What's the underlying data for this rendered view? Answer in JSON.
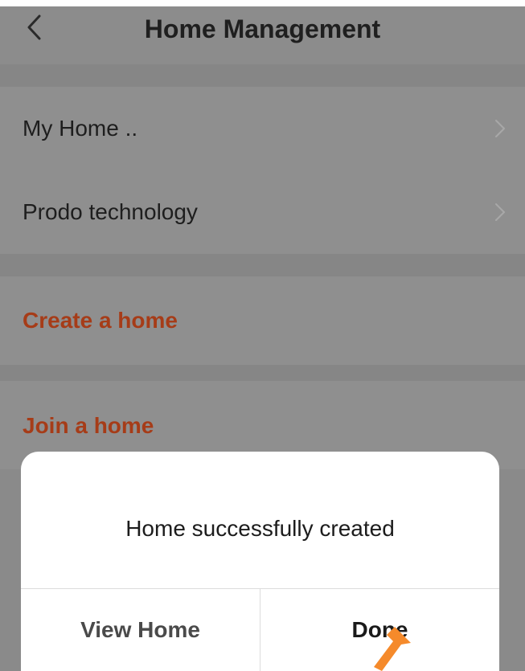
{
  "header": {
    "title": "Home Management",
    "back_icon": "chevron-left-icon"
  },
  "homes": [
    {
      "label": "My Home .."
    },
    {
      "label": "Prodo technology"
    }
  ],
  "actions": {
    "create_label": "Create a home",
    "join_label": "Join a home",
    "accent_color": "#a63c18"
  },
  "dialog": {
    "message": "Home successfully created",
    "view_home_label": "View Home",
    "done_label": "Done"
  },
  "overlay": {
    "pointer_icon": "orange-arrow-pointer-icon",
    "pointer_color": "#f58a2b"
  }
}
